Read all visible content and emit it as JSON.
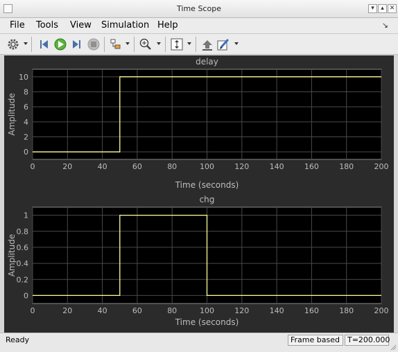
{
  "window": {
    "title": "Time Scope"
  },
  "menu": [
    {
      "label": "File"
    },
    {
      "label": "Tools"
    },
    {
      "label": "View"
    },
    {
      "label": "Simulation"
    },
    {
      "label": "Help"
    }
  ],
  "toolbar": {
    "icons": [
      "gear-icon",
      "step-back-icon",
      "run-icon",
      "step-forward-icon",
      "stop-icon",
      "signal-highlight-icon",
      "zoom-in-icon",
      "scale-axes-icon",
      "restore-view-icon",
      "style-icon"
    ]
  },
  "colors": {
    "plot_bg": "#000000",
    "figure_bg": "#2b2b2b",
    "grid": "#4a4a4a",
    "axis_text": "#bdbdbd",
    "signal": "#ffff99"
  },
  "chart_data": [
    {
      "type": "line",
      "title": "delay",
      "xlabel": "Time (seconds)",
      "ylabel": "Amplitude",
      "xlim": [
        0,
        200
      ],
      "ylim": [
        -1,
        11
      ],
      "xticks": [
        0,
        20,
        40,
        60,
        80,
        100,
        120,
        140,
        160,
        180,
        200
      ],
      "yticks": [
        0,
        2,
        4,
        6,
        8,
        10
      ],
      "ytick_labels": [
        "0",
        "2",
        "4",
        "6",
        "8",
        "10"
      ],
      "grid": true,
      "series": [
        {
          "x": [
            0,
            50,
            50,
            200
          ],
          "y": [
            0,
            0,
            10,
            10
          ]
        }
      ]
    },
    {
      "type": "line",
      "title": "chg",
      "xlabel": "Time (seconds)",
      "ylabel": "Amplitude",
      "xlim": [
        0,
        200
      ],
      "ylim": [
        -0.1,
        1.1
      ],
      "xticks": [
        0,
        20,
        40,
        60,
        80,
        100,
        120,
        140,
        160,
        180,
        200
      ],
      "yticks": [
        0,
        0.2,
        0.4,
        0.6,
        0.8,
        1
      ],
      "ytick_labels": [
        "0",
        "0.2",
        "0.4",
        "0.6",
        "0.8",
        "1"
      ],
      "grid": true,
      "series": [
        {
          "x": [
            0,
            50,
            50,
            100,
            100,
            200
          ],
          "y": [
            0,
            0,
            1,
            1,
            0,
            0
          ]
        }
      ]
    }
  ],
  "status": {
    "ready": "Ready",
    "mode": "Frame based",
    "time": "T=200.000"
  }
}
